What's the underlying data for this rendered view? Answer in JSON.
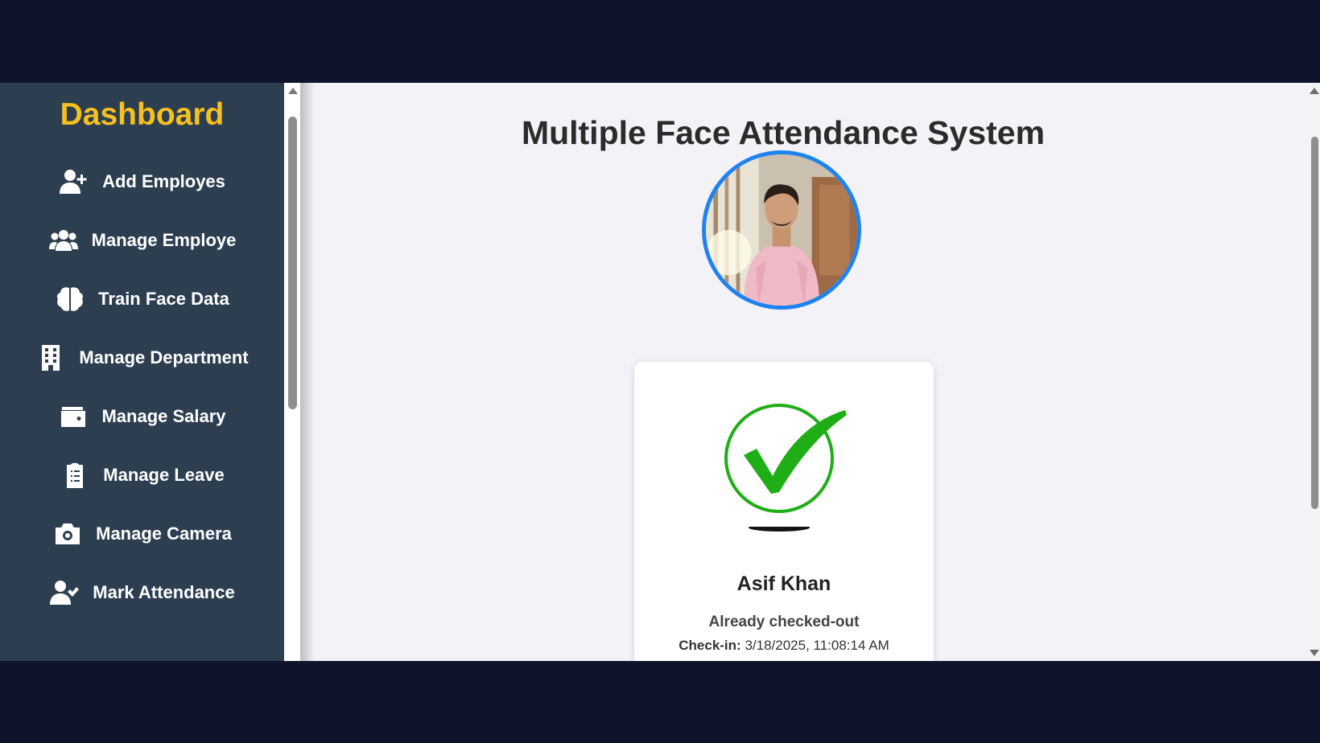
{
  "sidebar": {
    "brand": "Dashboard",
    "items": [
      {
        "label": "Add Employes",
        "icon": "user-plus-icon"
      },
      {
        "label": "Manage Employe",
        "icon": "users-icon"
      },
      {
        "label": "Train Face Data",
        "icon": "brain-icon"
      },
      {
        "label": "Manage Department",
        "icon": "building-icon"
      },
      {
        "label": "Manage Salary",
        "icon": "wallet-icon"
      },
      {
        "label": "Manage Leave",
        "icon": "clipboard-icon"
      },
      {
        "label": "Manage Camera",
        "icon": "camera-icon"
      },
      {
        "label": "Mark Attendance",
        "icon": "user-check-icon"
      }
    ]
  },
  "main": {
    "title": "Multiple Face Attendance System",
    "result": {
      "name": "Asif Khan",
      "status": "Already checked-out",
      "checkin_label": "Check-in:",
      "checkin_value": "3/18/2025, 11:08:14 AM"
    }
  },
  "colors": {
    "brand": "#f5c020",
    "sidebar_bg": "#2c3e50",
    "avatar_ring": "#1e82f0",
    "success": "#1fae16"
  }
}
